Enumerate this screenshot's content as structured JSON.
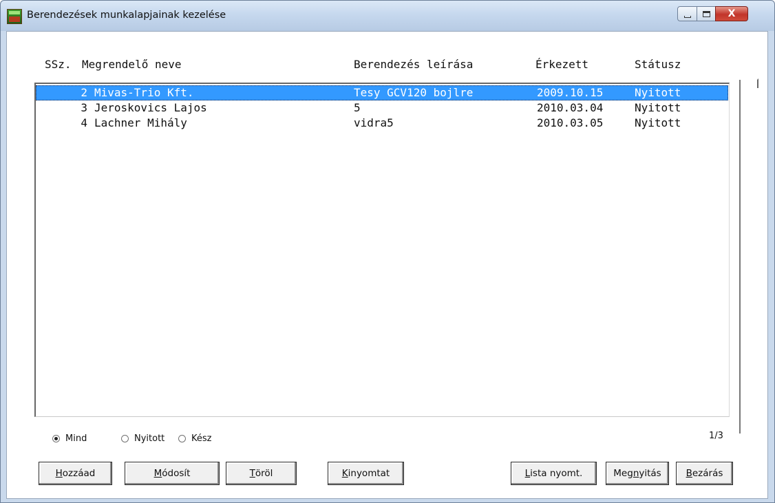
{
  "window": {
    "title": "Berendezések munkalapjainak kezelése",
    "close_glyph": "X"
  },
  "columns": {
    "ssz": "SSz.",
    "name": "Megrendelő neve",
    "desc": "Berendezés leírása",
    "date": "Érkezett",
    "status": "Státusz"
  },
  "rows": [
    {
      "no": "2",
      "name": "Mivas-Trio Kft.",
      "desc": "Tesy GCV120 bojlre",
      "date": "2009.10.15",
      "status": "Nyitott",
      "selected": true
    },
    {
      "no": "3",
      "name": "Jeroskovics Lajos",
      "desc": "5",
      "date": "2010.03.04",
      "status": "Nyitott",
      "selected": false
    },
    {
      "no": "4",
      "name": "Lachner Mihály",
      "desc": "vidra5",
      "date": "2010.03.05",
      "status": "Nyitott",
      "selected": false
    }
  ],
  "page_indicator": "1/3",
  "filter": {
    "selected": "Mind",
    "options": [
      "Mind",
      "Nyitott",
      "Kész"
    ]
  },
  "buttons": {
    "hozzaad": {
      "acc": "H",
      "rest": "ozzáad"
    },
    "modosit": {
      "acc": "M",
      "rest": "ódosít"
    },
    "torol": {
      "acc": "T",
      "rest": "öröl"
    },
    "kinyomtat": {
      "acc": "K",
      "rest": "inyomtat"
    },
    "lista": {
      "acc": "L",
      "rest": "ista nyomt."
    },
    "megnyitas": {
      "pre": "Meg",
      "acc": "n",
      "rest": "yitás"
    },
    "bezaras": {
      "acc": "B",
      "rest": "ezárás"
    }
  },
  "colors": {
    "selection": "#3399ff",
    "titlebar": "#c6d8ee",
    "close_button": "#c2352a"
  }
}
